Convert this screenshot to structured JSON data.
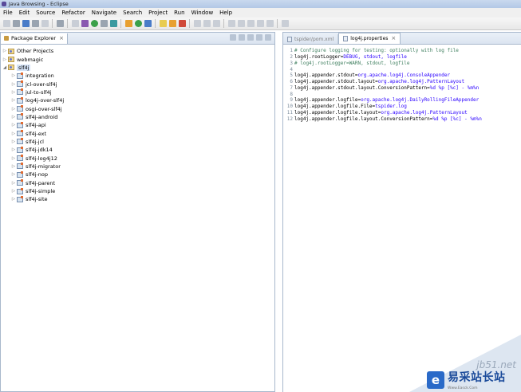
{
  "window": {
    "title": "Java Browsing - Eclipse"
  },
  "menu": [
    "File",
    "Edit",
    "Source",
    "Refactor",
    "Navigate",
    "Search",
    "Project",
    "Run",
    "Window",
    "Help"
  ],
  "package_explorer": {
    "tab_label": "Package Explorer",
    "tree": [
      {
        "label": "Other Projects",
        "level": 0,
        "expanded": false,
        "icon": "project-folder-icon"
      },
      {
        "label": "webmagic",
        "level": 0,
        "expanded": false,
        "icon": "project-folder-icon"
      },
      {
        "label": "slf4j",
        "level": 0,
        "expanded": true,
        "selected": true,
        "icon": "project-folder-icon"
      },
      {
        "label": "integration",
        "level": 1,
        "expanded": false,
        "icon": "maven-project-icon"
      },
      {
        "label": "jcl-over-slf4j",
        "level": 1,
        "expanded": false,
        "icon": "maven-project-icon"
      },
      {
        "label": "jul-to-slf4j",
        "level": 1,
        "expanded": false,
        "icon": "maven-project-icon"
      },
      {
        "label": "log4j-over-slf4j",
        "level": 1,
        "expanded": false,
        "icon": "maven-project-icon"
      },
      {
        "label": "osgi-over-slf4j",
        "level": 1,
        "expanded": false,
        "icon": "maven-project-icon"
      },
      {
        "label": "slf4j-android",
        "level": 1,
        "expanded": false,
        "icon": "maven-project-icon"
      },
      {
        "label": "slf4j-api",
        "level": 1,
        "expanded": false,
        "icon": "maven-project-icon"
      },
      {
        "label": "slf4j-ext",
        "level": 1,
        "expanded": false,
        "icon": "maven-project-icon"
      },
      {
        "label": "slf4j-jcl",
        "level": 1,
        "expanded": false,
        "icon": "maven-project-icon"
      },
      {
        "label": "slf4j-jdk14",
        "level": 1,
        "expanded": false,
        "icon": "maven-project-icon"
      },
      {
        "label": "slf4j-log4j12",
        "level": 1,
        "expanded": false,
        "icon": "maven-project-icon"
      },
      {
        "label": "slf4j-migrator",
        "level": 1,
        "expanded": false,
        "icon": "maven-project-icon"
      },
      {
        "label": "slf4j-nop",
        "level": 1,
        "expanded": false,
        "icon": "maven-project-icon"
      },
      {
        "label": "slf4j-parent",
        "level": 1,
        "expanded": false,
        "icon": "maven-project-icon"
      },
      {
        "label": "slf4j-simple",
        "level": 1,
        "expanded": false,
        "icon": "maven-project-icon"
      },
      {
        "label": "slf4j-site",
        "level": 1,
        "expanded": false,
        "icon": "maven-project-icon"
      }
    ]
  },
  "editor": {
    "tabs": [
      {
        "label": "tspider/pom.xml",
        "active": false
      },
      {
        "label": "log4j.properties",
        "active": true
      }
    ],
    "lines": [
      {
        "n": "1",
        "key": "# Configure logging for testing: optionally with log file",
        "value": "",
        "comment": true
      },
      {
        "n": "2",
        "key": "log4j.rootLogger=",
        "value": "DEBUG, stdout, logfile",
        "comment": false
      },
      {
        "n": "3",
        "key": "# log4j.rootLogger=WARN, stdout, logfile",
        "value": "",
        "comment": true
      },
      {
        "n": "4",
        "key": "",
        "value": "",
        "comment": false
      },
      {
        "n": "5",
        "key": "log4j.appender.stdout=",
        "value": "org.apache.log4j.ConsoleAppender",
        "comment": false
      },
      {
        "n": "6",
        "key": "log4j.appender.stdout.layout=",
        "value": "org.apache.log4j.PatternLayout",
        "comment": false
      },
      {
        "n": "7",
        "key": "log4j.appender.stdout.layout.ConversionPattern=",
        "value": "%d %p [%c] - %m%n",
        "comment": false
      },
      {
        "n": "8",
        "key": "",
        "value": "",
        "comment": false
      },
      {
        "n": "9",
        "key": "log4j.appender.logfile=",
        "value": "org.apache.log4j.DailyRollingFileAppender",
        "comment": false
      },
      {
        "n": "10",
        "key": "log4j.appender.logfile.File=",
        "value": "tspider.log",
        "comment": false
      },
      {
        "n": "11",
        "key": "log4j.appender.logfile.layout=",
        "value": "org.apache.log4j.PatternLayout",
        "comment": false
      },
      {
        "n": "12",
        "key": "log4j.appender.logfile.layout.ConversionPattern=",
        "value": "%d %p [%c] - %m%n",
        "comment": false
      }
    ]
  },
  "watermark": {
    "url": "jb51.net",
    "name": "易采站长站",
    "sub": "Www.Easck.Com"
  }
}
